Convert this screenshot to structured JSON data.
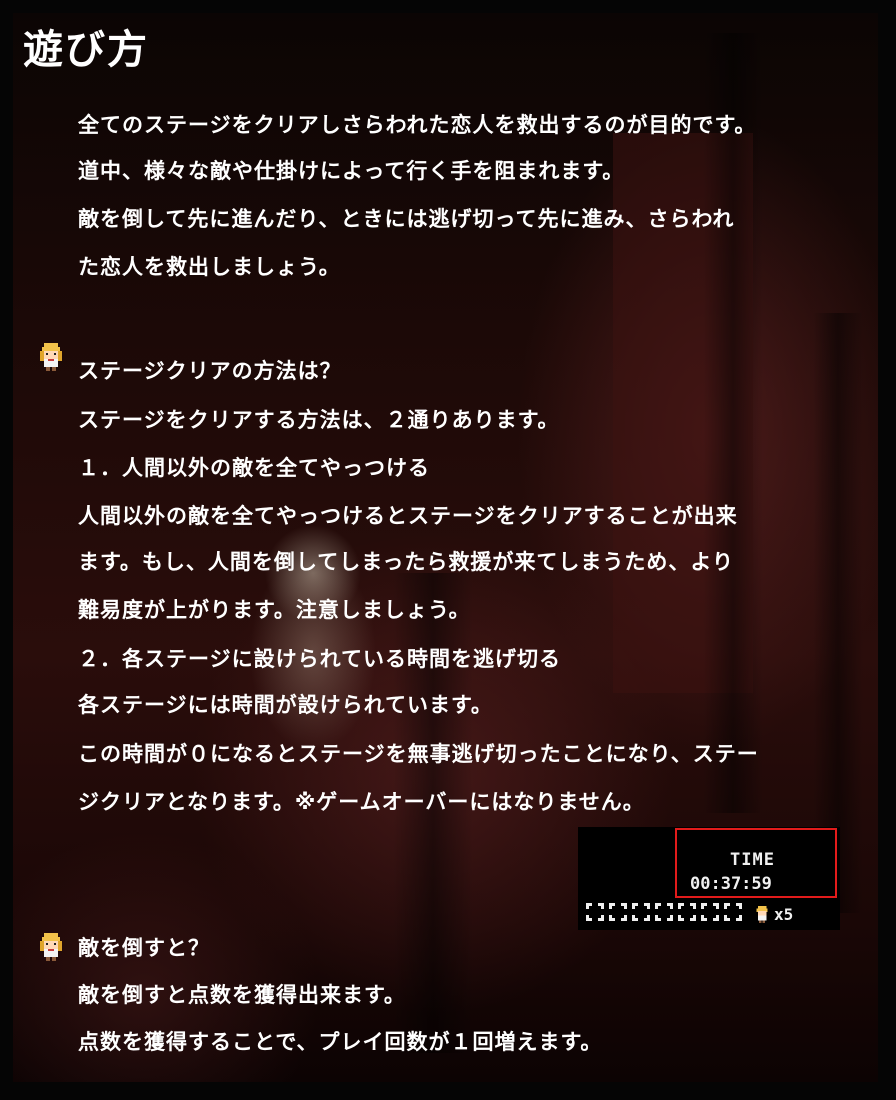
{
  "title": "遊び方",
  "intro": [
    "全てのステージをクリアしさらわれた恋人を救出するのが目的です。",
    "道中、様々な敵や仕掛けによって行く手を阻まれます。",
    "敵を倒して先に進んだり、ときには逃げ切って先に進み、さらわれ",
    "た恋人を救出しましょう。"
  ],
  "section_clear": {
    "icon": "heroine-sprite-icon",
    "heading": "ステージクリアの方法は？",
    "lines": [
      "ステージをクリアする方法は、２通りあります。",
      "１．人間以外の敵を全てやっつける",
      "人間以外の敵を全てやっつけるとステージをクリアすることが出来",
      "ます。もし、人間を倒してしまったら救援が来てしまうため、より",
      "難易度が上がります。注意しましょう。",
      "２．各ステージに設けられている時間を逃げ切る",
      "各ステージには時間が設けられています。",
      "この時間が０になるとステージを無事逃げ切ったことになり、ステー",
      "ジクリアとなります。※ゲームオーバーにはなりません。"
    ]
  },
  "hud": {
    "time_label": "TIME",
    "time_value": "00:37:59",
    "lives_count": "x5",
    "highlight_color": "#e21b1b"
  },
  "section_enemy": {
    "icon": "heroine-sprite-icon",
    "heading": "敵を倒すと？",
    "lines": [
      "敵を倒すと点数を獲得出来ます。",
      "点数を獲得することで、プレイ回数が１回増えます。"
    ]
  }
}
